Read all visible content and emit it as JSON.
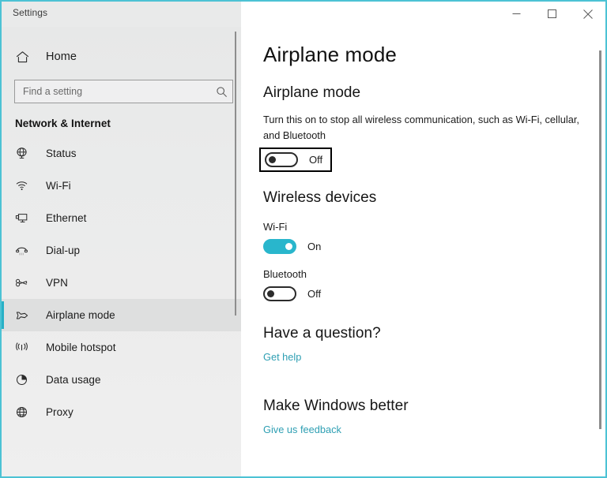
{
  "window": {
    "title": "Settings",
    "accent_color": "#29b6cc",
    "border_color": "#4cc2d4",
    "controls": {
      "minimize": "minimize-button",
      "maximize": "maximize-button",
      "close": "close-button"
    }
  },
  "sidebar": {
    "home": {
      "label": "Home",
      "icon": "home-icon"
    },
    "search": {
      "placeholder": "Find a setting",
      "value": "",
      "icon": "search-icon"
    },
    "group_title": "Network & Internet",
    "items": [
      {
        "label": "Status",
        "icon": "globe-status-icon",
        "selected": false
      },
      {
        "label": "Wi-Fi",
        "icon": "wifi-icon",
        "selected": false
      },
      {
        "label": "Ethernet",
        "icon": "ethernet-icon",
        "selected": false
      },
      {
        "label": "Dial-up",
        "icon": "dialup-phone-icon",
        "selected": false
      },
      {
        "label": "VPN",
        "icon": "vpn-key-icon",
        "selected": false
      },
      {
        "label": "Airplane mode",
        "icon": "airplane-icon",
        "selected": true
      },
      {
        "label": "Mobile hotspot",
        "icon": "broadcast-icon",
        "selected": false
      },
      {
        "label": "Data usage",
        "icon": "pie-chart-icon",
        "selected": false
      },
      {
        "label": "Proxy",
        "icon": "globe-icon",
        "selected": false
      }
    ]
  },
  "main": {
    "page_title": "Airplane mode",
    "airplane_section": {
      "heading": "Airplane mode",
      "description": "Turn this on to stop all wireless communication, such as Wi-Fi, cellular, and Bluetooth",
      "toggle": {
        "state_label": "Off",
        "on": false,
        "focused": true
      }
    },
    "wireless_section": {
      "heading": "Wireless devices",
      "devices": [
        {
          "label": "Wi-Fi",
          "state_label": "On",
          "on": true
        },
        {
          "label": "Bluetooth",
          "state_label": "Off",
          "on": false
        }
      ]
    },
    "question_section": {
      "heading": "Have a question?",
      "link": "Get help"
    },
    "feedback_section": {
      "heading": "Make Windows better",
      "link": "Give us feedback"
    }
  }
}
